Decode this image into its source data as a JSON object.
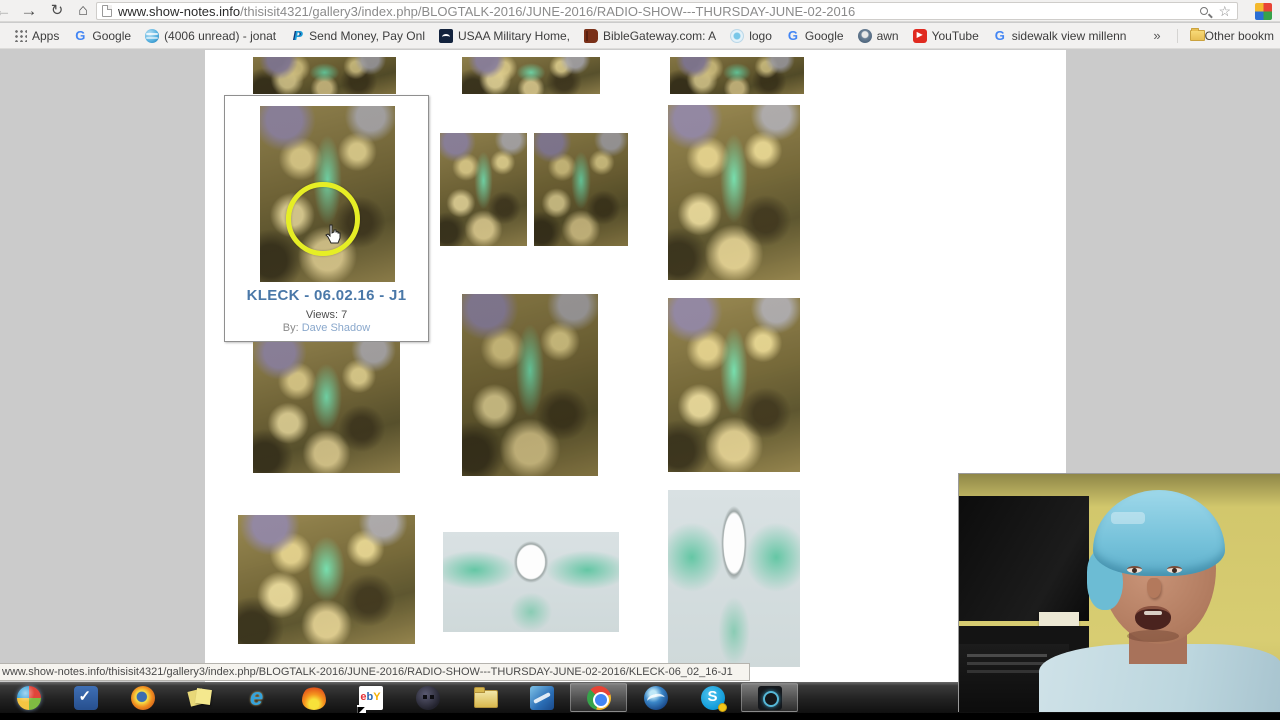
{
  "browser": {
    "back_icon": "←",
    "forward_icon": "→",
    "reload_icon": "↻",
    "home_icon": "⌂",
    "url_domain": "www.show-notes.info",
    "url_path": "/thisisit4321/gallery3/index.php/BLOGTALK-2016/JUNE-2016/RADIO-SHOW---THURSDAY-JUNE-02-2016",
    "star_icon": "☆",
    "bookmarks": [
      {
        "label": "Apps",
        "icon": "apps-grid-icon"
      },
      {
        "label": "Google",
        "icon": "google-g-icon"
      },
      {
        "label": "(4006 unread) - jonat",
        "icon": "att-globe-icon"
      },
      {
        "label": "Send Money, Pay Onl",
        "icon": "paypal-icon"
      },
      {
        "label": "USAA Military Home,",
        "icon": "usaa-eagle-icon"
      },
      {
        "label": "BibleGateway.com: A",
        "icon": "bible-book-icon"
      },
      {
        "label": "logo",
        "icon": "dot-circle-icon"
      },
      {
        "label": "Google",
        "icon": "google-g-icon"
      },
      {
        "label": "awn",
        "icon": "awn-icon"
      },
      {
        "label": "YouTube",
        "icon": "youtube-icon"
      },
      {
        "label": "sidewalk view millenn",
        "icon": "google-g-icon"
      }
    ],
    "overflow_chevron": "»",
    "other_bookmarks_label": "Other bookm"
  },
  "gallery": {
    "selected": {
      "title": "KLECK - 06.02.16 - J1",
      "views": "Views: 7",
      "by_label": "By: ",
      "author": "Dave Shadow"
    }
  },
  "status_bar": {
    "url": "www.show-notes.info/thisisit4321/gallery3/index.php/BLOGTALK-2016/JUNE-2016/RADIO-SHOW---THURSDAY-JUNE-02-2016/KLECK-06_02_16-J1"
  },
  "taskbar": {
    "ebay_letters": {
      "e": "e",
      "b": "b",
      "y1": "Y",
      "y2": ""
    },
    "apps": [
      {
        "name": "windows-start"
      },
      {
        "name": "checkmark-app"
      },
      {
        "name": "firefox"
      },
      {
        "name": "sticky-notes"
      },
      {
        "name": "internet-explorer"
      },
      {
        "name": "flame-app"
      },
      {
        "name": "ebay"
      },
      {
        "name": "webcam-app"
      },
      {
        "name": "windows-explorer"
      },
      {
        "name": "media-app"
      },
      {
        "name": "google-chrome",
        "active": true
      },
      {
        "name": "google-earth"
      },
      {
        "name": "skype"
      },
      {
        "name": "screen-recorder",
        "active": true
      }
    ]
  },
  "colors": {
    "caption_blue": "#4a78a8",
    "author_blue": "#8aa8cc",
    "annotation_yellow": "#e6ee25",
    "page_bg": "#cbcbcb"
  }
}
